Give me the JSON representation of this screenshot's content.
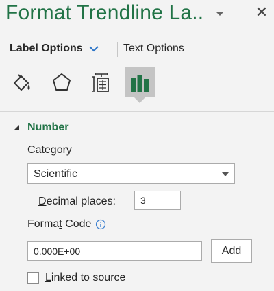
{
  "header": {
    "title": "Format Trendline La..",
    "close_glyph": "✕"
  },
  "tabs": {
    "label_options": "Label Options",
    "text_options": "Text Options"
  },
  "icons": [
    "fill-line-icon",
    "effects-icon",
    "size-properties-icon",
    "label-options-icon"
  ],
  "section": {
    "title": "Number",
    "expanded": true
  },
  "category": {
    "label_underlined": "C",
    "label_rest": "ategory",
    "selected": "Scientific"
  },
  "decimal": {
    "label_underlined": "D",
    "label_rest": "ecimal places:",
    "value": "3"
  },
  "format_code": {
    "label_before": "Forma",
    "label_underlined": "t",
    "label_after": " Code",
    "value": "0.000E+00"
  },
  "add_button": {
    "underlined": "A",
    "rest": "dd"
  },
  "linked": {
    "underlined": "L",
    "rest": "inked to source",
    "checked": false
  },
  "colors": {
    "accent": "#217346",
    "panel_bg": "#f3f3f3",
    "active_icon_bg": "#c4c4c4",
    "info_blue": "#3b7fd0",
    "tab_chevron": "#2b74c7"
  }
}
